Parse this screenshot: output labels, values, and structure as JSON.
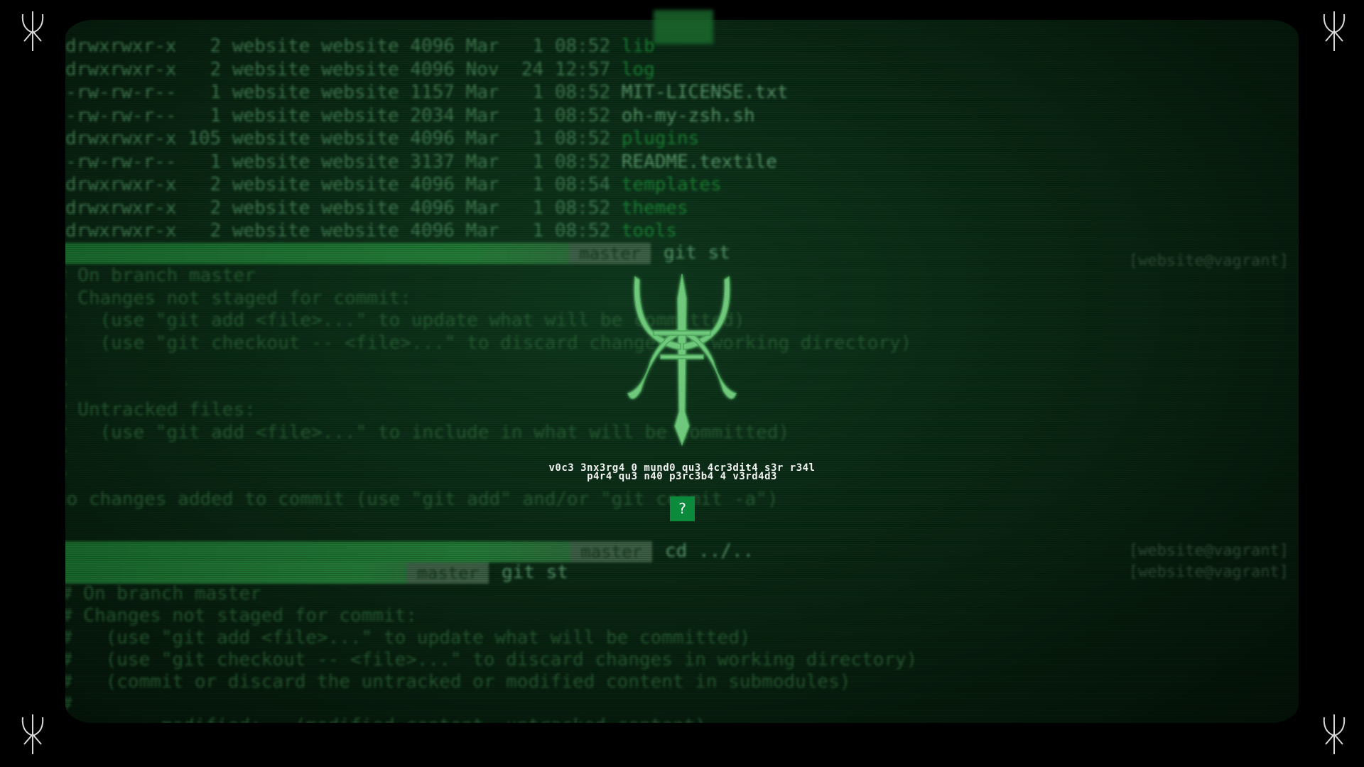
{
  "terminal": {
    "ls_rows": [
      {
        "perm": "drwxrwxr-x",
        "links": "2",
        "user": "website",
        "group": "website",
        "size": "4096",
        "month": "Mar",
        "day": "1",
        "time": "08:52",
        "name": "lib",
        "is_dir": true
      },
      {
        "perm": "drwxrwxr-x",
        "links": "2",
        "user": "website",
        "group": "website",
        "size": "4096",
        "month": "Nov",
        "day": "24",
        "time": "12:57",
        "name": "log",
        "is_dir": true
      },
      {
        "perm": "-rw-rw-r--",
        "links": "1",
        "user": "website",
        "group": "website",
        "size": "1157",
        "month": "Mar",
        "day": "1",
        "time": "08:52",
        "name": "MIT-LICENSE.txt",
        "is_dir": false
      },
      {
        "perm": "-rw-rw-r--",
        "links": "1",
        "user": "website",
        "group": "website",
        "size": "2034",
        "month": "Mar",
        "day": "1",
        "time": "08:52",
        "name": "oh-my-zsh.sh",
        "is_dir": false
      },
      {
        "perm": "drwxrwxr-x",
        "links": "105",
        "user": "website",
        "group": "website",
        "size": "4096",
        "month": "Mar",
        "day": "1",
        "time": "08:52",
        "name": "plugins",
        "is_dir": true
      },
      {
        "perm": "-rw-rw-r--",
        "links": "1",
        "user": "website",
        "group": "website",
        "size": "3137",
        "month": "Mar",
        "day": "1",
        "time": "08:52",
        "name": "README.textile",
        "is_dir": false
      },
      {
        "perm": "drwxrwxr-x",
        "links": "2",
        "user": "website",
        "group": "website",
        "size": "4096",
        "month": "Mar",
        "day": "1",
        "time": "08:54",
        "name": "templates",
        "is_dir": true
      },
      {
        "perm": "drwxrwxr-x",
        "links": "2",
        "user": "website",
        "group": "website",
        "size": "4096",
        "month": "Mar",
        "day": "1",
        "time": "08:52",
        "name": "themes",
        "is_dir": true
      },
      {
        "perm": "drwxrwxr-x",
        "links": "2",
        "user": "website",
        "group": "website",
        "size": "4096",
        "month": "Mar",
        "day": "1",
        "time": "08:52",
        "name": "tools",
        "is_dir": true
      }
    ],
    "prompt1": {
      "branch": "master",
      "command": "git st",
      "host_tag": "[website@vagrant]"
    },
    "status_block_1": [
      "# On branch master",
      "# Changes not staged for commit:",
      "#   (use \"git add <file>...\" to update what will be committed)",
      "#   (use \"git checkout -- <file>...\" to discard changes in working directory)",
      "#",
      "#",
      "# Untracked files:",
      "#   (use \"git add <file>...\" to include in what will be committed)",
      "#",
      "#",
      "no changes added to commit (use \"git add\" and/or \"git commit -a\")"
    ],
    "prompt2": {
      "branch": "master",
      "command": "cd ../..",
      "host_tag": "[website@vagrant]"
    },
    "prompt3": {
      "branch": "master",
      "command": "git st",
      "host_tag": "[website@vagrant]"
    },
    "status_block_2": [
      "# On branch master",
      "# Changes not staged for commit:",
      "#   (use \"git add <file>...\" to update what will be committed)",
      "#   (use \"git checkout -- <file>...\" to discard changes in working directory)",
      "#   (commit or discard the untracked or modified content in submodules)",
      "#",
      "#        modified:   (modified content, untracked content)"
    ]
  },
  "overlay": {
    "riddle_line_1": "v0c3 3nx3rg4 0 mund0 qu3 4cr3dit4 s3r r34l",
    "riddle_line_2": "p4r4 qu3 n40 p3rc3b4 4 v3rd4d3",
    "help_label": "?",
    "emblem_icon": "trident-sigil-icon",
    "corner_icon": "sigil-icon"
  },
  "colors": {
    "crt_green": "#0a2814",
    "emblem_green": "#6fc87c",
    "help_button": "#0a8a3a",
    "corner_sigil": "#d8d8d8"
  }
}
